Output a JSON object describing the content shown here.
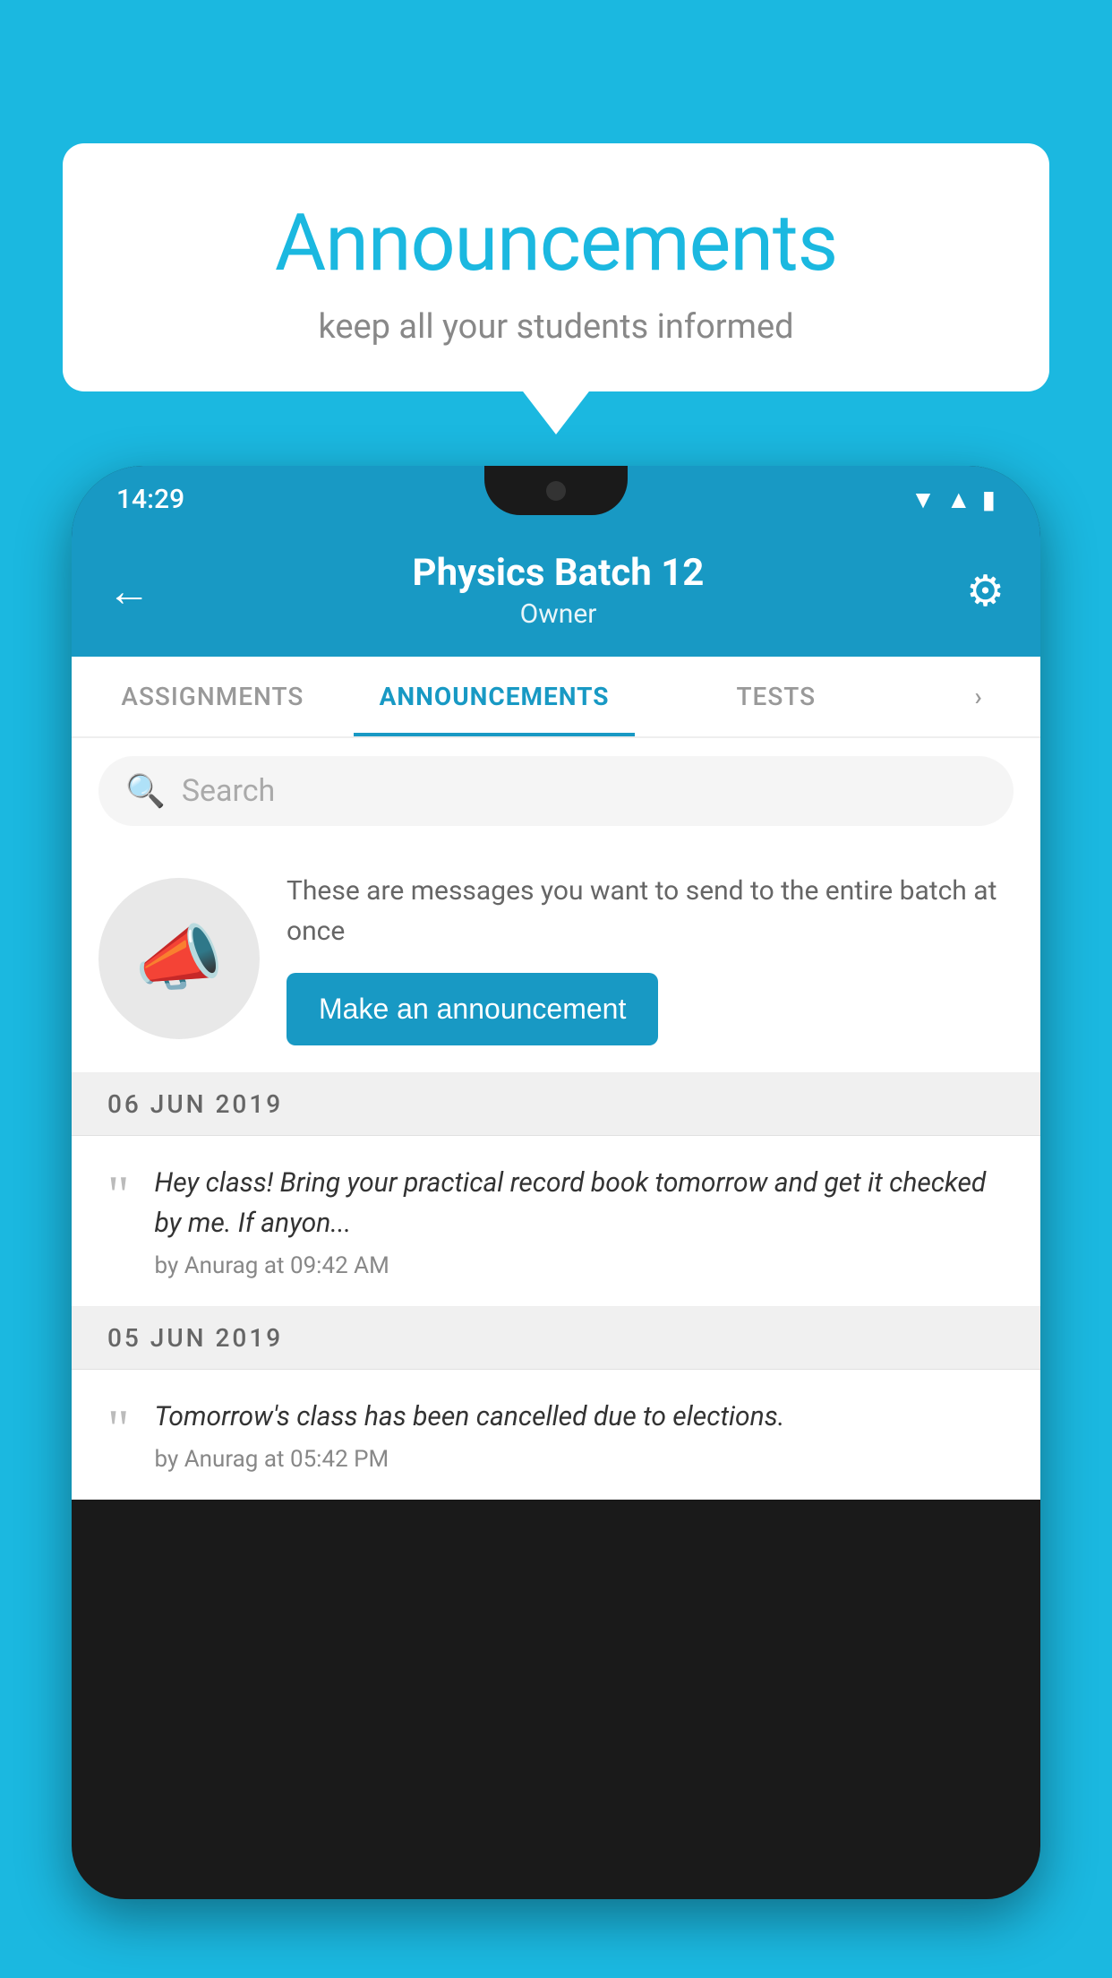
{
  "background_color": "#1bb8e0",
  "speech_bubble": {
    "title": "Announcements",
    "subtitle": "keep all your students informed"
  },
  "phone": {
    "status_bar": {
      "time": "14:29"
    },
    "header": {
      "title": "Physics Batch 12",
      "subtitle": "Owner",
      "back_label": "←",
      "gear_label": "⚙"
    },
    "tabs": [
      {
        "label": "ASSIGNMENTS",
        "active": false
      },
      {
        "label": "ANNOUNCEMENTS",
        "active": true
      },
      {
        "label": "TESTS",
        "active": false
      },
      {
        "label": "···",
        "active": false
      }
    ],
    "search": {
      "placeholder": "Search"
    },
    "promo": {
      "description": "These are messages you want to send to the entire batch at once",
      "button_label": "Make an announcement"
    },
    "announcements": [
      {
        "date": "06  JUN  2019",
        "text": "Hey class! Bring your practical record book tomorrow and get it checked by me. If anyon...",
        "meta": "by Anurag at 09:42 AM"
      },
      {
        "date": "05  JUN  2019",
        "text": "Tomorrow's class has been cancelled due to elections.",
        "meta": "by Anurag at 05:42 PM"
      }
    ]
  }
}
